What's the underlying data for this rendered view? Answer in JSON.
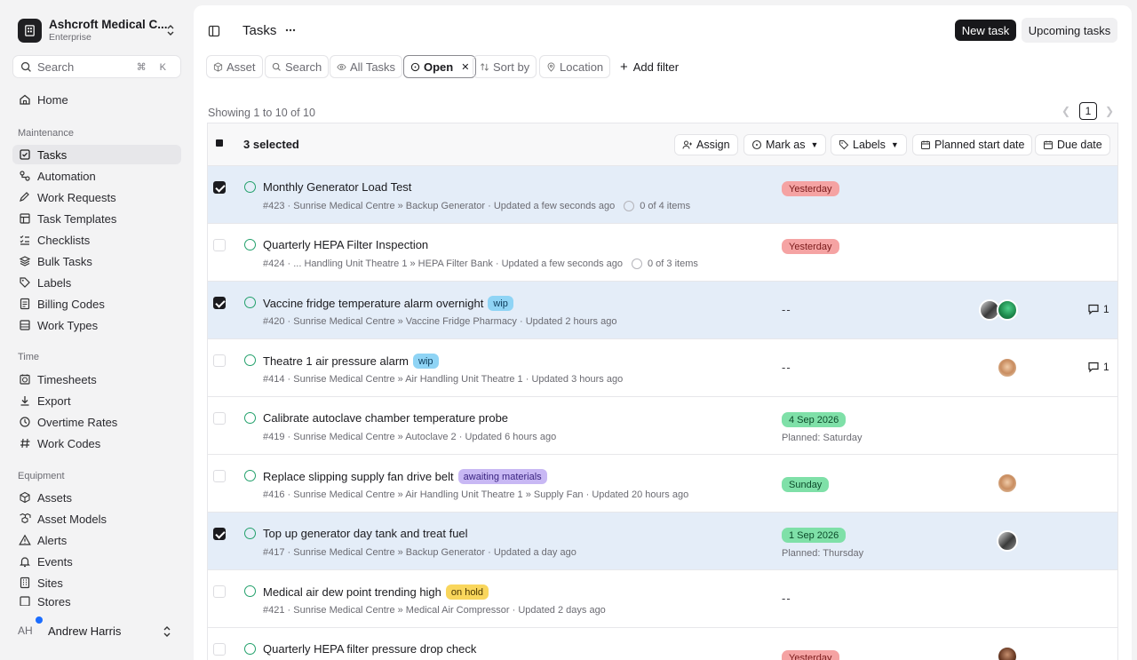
{
  "org": {
    "name": "Ashcroft Medical C...",
    "plan": "Enterprise"
  },
  "search": {
    "placeholder": "Search",
    "shortcut": "⌘ K"
  },
  "nav": {
    "home": "Home",
    "maintenance": {
      "heading": "Maintenance",
      "items": [
        "Tasks",
        "Automation",
        "Work Requests",
        "Task Templates",
        "Checklists",
        "Bulk Tasks",
        "Labels",
        "Billing Codes",
        "Work Types"
      ]
    },
    "time": {
      "heading": "Time",
      "items": [
        "Timesheets",
        "Export",
        "Overtime Rates",
        "Work Codes"
      ]
    },
    "equipment": {
      "heading": "Equipment",
      "items": [
        "Assets",
        "Asset Models",
        "Alerts",
        "Events",
        "Sites",
        "Stores"
      ]
    }
  },
  "user": {
    "initials": "AH",
    "name": "Andrew Harris"
  },
  "page": {
    "title": "Tasks",
    "new_task": "New task",
    "upcoming": "Upcoming tasks"
  },
  "filters": {
    "asset": "Asset",
    "search": "Search",
    "all": "All Tasks",
    "open": "Open",
    "sort": "Sort by",
    "location": "Location",
    "add": "Add filter"
  },
  "pagination": {
    "showing": "Showing 1 to 10 of 10",
    "page": "1"
  },
  "toolbar": {
    "selected": "3 selected",
    "assign": "Assign",
    "mark_as": "Mark as",
    "labels": "Labels",
    "planned_start": "Planned start date",
    "due_date": "Due date"
  },
  "tasks": [
    {
      "title": "Monthly Generator Load Test",
      "meta": "#423 · Sunrise Medical Centre » Backup Generator · Updated a few seconds ago",
      "progress": "0 of 4 items",
      "due": "Yesterday",
      "selected": true
    },
    {
      "title": "Quarterly HEPA Filter Inspection",
      "meta": "#424 · ... Handling Unit Theatre 1 » HEPA Filter Bank · Updated a few seconds ago",
      "progress": "0 of 3 items",
      "due": "Yesterday",
      "selected": false
    },
    {
      "title": "Vaccine fridge temperature alarm overnight",
      "label": "wip",
      "meta": "#420 · Sunrise Medical Centre » Vaccine Fridge Pharmacy · Updated 2 hours ago",
      "due": "--",
      "comments": "1",
      "selected": true
    },
    {
      "title": "Theatre 1 air pressure alarm",
      "label": "wip",
      "meta": "#414 · Sunrise Medical Centre » Air Handling Unit Theatre 1 · Updated 3 hours ago",
      "due": "--",
      "comments": "1",
      "selected": false
    },
    {
      "title": "Calibrate autoclave chamber temperature probe",
      "meta": "#419 · Sunrise Medical Centre » Autoclave 2 · Updated 6 hours ago",
      "due": "4 Sep 2026",
      "planned": "Planned: Saturday",
      "selected": false
    },
    {
      "title": "Replace slipping supply fan drive belt",
      "label": "awaiting materials",
      "meta": "#416 · Sunrise Medical Centre » Air Handling Unit Theatre 1 » Supply Fan · Updated 20 hours ago",
      "due": "Sunday",
      "selected": false
    },
    {
      "title": "Top up generator day tank and treat fuel",
      "meta": "#417 · Sunrise Medical Centre » Backup Generator · Updated a day ago",
      "due": "1 Sep 2026",
      "planned": "Planned: Thursday",
      "selected": true
    },
    {
      "title": "Medical air dew point trending high",
      "label": "on hold",
      "meta": "#421 · Sunrise Medical Centre » Medical Air Compressor · Updated 2 days ago",
      "due": "--",
      "selected": false
    },
    {
      "title": "Quarterly HEPA filter pressure drop check",
      "due": "Yesterday",
      "selected": false
    }
  ]
}
